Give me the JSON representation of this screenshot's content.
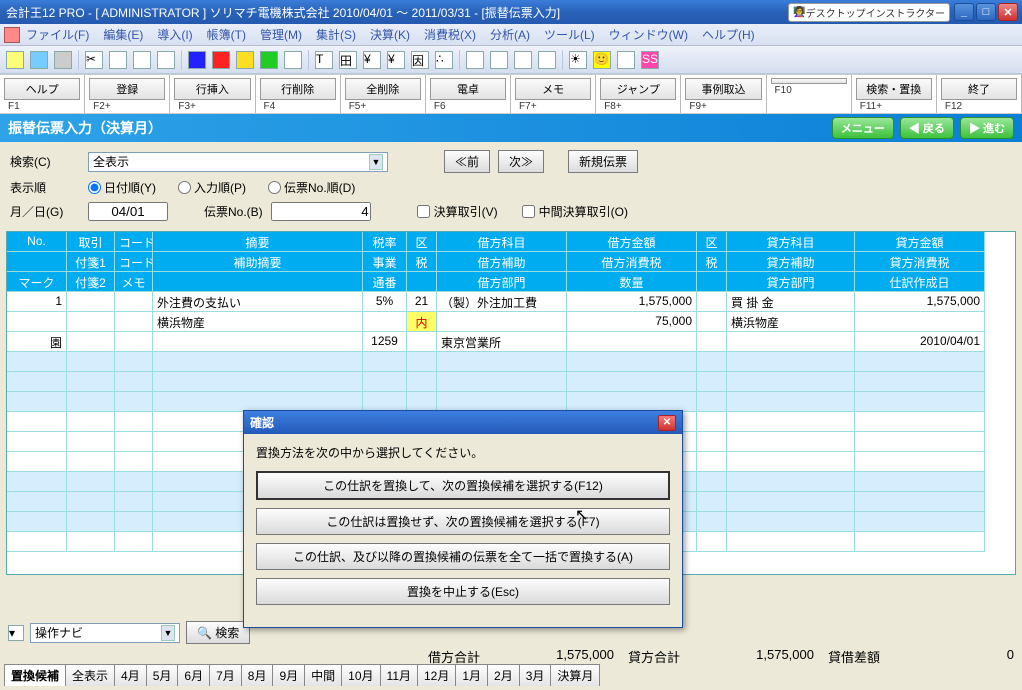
{
  "title": "会計王12 PRO - [ ADMINISTRATOR ] ソリマチ電機株式会社 2010/04/01 ～ 2011/03/31 - [振替伝票入力]",
  "instructor": "デスクトップインストラクター",
  "menu": [
    "ファイル(F)",
    "編集(E)",
    "導入(I)",
    "帳簿(T)",
    "管理(M)",
    "集計(S)",
    "決算(K)",
    "消費税(X)",
    "分析(A)",
    "ツール(L)",
    "ウィンドウ(W)",
    "ヘルプ(H)"
  ],
  "fkeys": [
    {
      "label": "ヘルプ",
      "key": "F1"
    },
    {
      "label": "登録",
      "key": "F2+"
    },
    {
      "label": "行挿入",
      "key": "F3+"
    },
    {
      "label": "行削除",
      "key": "F4"
    },
    {
      "label": "全削除",
      "key": "F5+"
    },
    {
      "label": "電卓",
      "key": "F6"
    },
    {
      "label": "メモ",
      "key": "F7+"
    },
    {
      "label": "ジャンプ",
      "key": "F8+"
    },
    {
      "label": "事例取込",
      "key": "F9+"
    },
    {
      "label": "",
      "key": "F10"
    },
    {
      "label": "検索・置換",
      "key": "F11+"
    },
    {
      "label": "終了",
      "key": "F12"
    }
  ],
  "bluehead": {
    "title": "振替伝票入力（決算月）",
    "menu": "メニュー",
    "back": "◀ 戻る",
    "fwd": "▶ 進む"
  },
  "filter": {
    "search_lbl": "検索(C)",
    "search_val": "全表示",
    "prev": "≪前",
    "next": "次≫",
    "new": "新規伝票",
    "order_lbl": "表示順",
    "r1": "日付順(Y)",
    "r2": "入力順(P)",
    "r3": "伝票No.順(D)",
    "md_lbl": "月／日(G)",
    "md_val": "04/01",
    "dno_lbl": "伝票No.(B)",
    "dno_val": "4",
    "chk1": "決算取引(V)",
    "chk2": "中間決算取引(O)"
  },
  "header_rows": [
    [
      "No.",
      "取引",
      "コード",
      "摘要",
      "税率",
      "区",
      "借方科目",
      "借方金額",
      "区",
      "貸方科目",
      "貸方金額"
    ],
    [
      "",
      "付箋1",
      "コード",
      "補助摘要",
      "事業",
      "税",
      "借方補助",
      "借方消費税",
      "税",
      "貸方補助",
      "貸方消費税"
    ],
    [
      "マーク",
      "付箋2",
      "メモ",
      "",
      "通番",
      "",
      "借方部門",
      "数量",
      "",
      "貸方部門",
      "仕訳作成日"
    ]
  ],
  "rows": [
    [
      "1",
      "",
      "",
      "外注費の支払い",
      "5%",
      "21",
      "（製）外注加工費",
      "1,575,000",
      "",
      "買 掛 金",
      "1,575,000"
    ],
    [
      "",
      "",
      "",
      "横浜物産",
      "",
      "内",
      "",
      "75,000",
      "",
      "横浜物産",
      ""
    ],
    [
      "園",
      "",
      "",
      "",
      "1259",
      "",
      "東京営業所",
      "",
      "",
      "",
      "2010/04/01"
    ]
  ],
  "bottom": {
    "navi": "操作ナビ",
    "search": "検索"
  },
  "totals": {
    "dr_lbl": "借方合計",
    "dr": "1,575,000",
    "cr_lbl": "貸方合計",
    "cr": "1,575,000",
    "diff_lbl": "貸借差額",
    "diff": "0"
  },
  "foottabs": [
    "置換候補",
    "全表示",
    "4月",
    "5月",
    "6月",
    "7月",
    "8月",
    "9月",
    "中間",
    "10月",
    "11月",
    "12月",
    "1月",
    "2月",
    "3月",
    "決算月"
  ],
  "dialog": {
    "title": "確認",
    "msg": "置換方法を次の中から選択してください。",
    "b1": "この仕訳を置換して、次の置換候補を選択する(F12)",
    "b2": "この仕訳は置換せず、次の置換候補を選択する(F7)",
    "b3": "この仕訳、及び以降の置換候補の伝票を全て一括で置換する(A)",
    "b4": "置換を中止する(Esc)"
  }
}
